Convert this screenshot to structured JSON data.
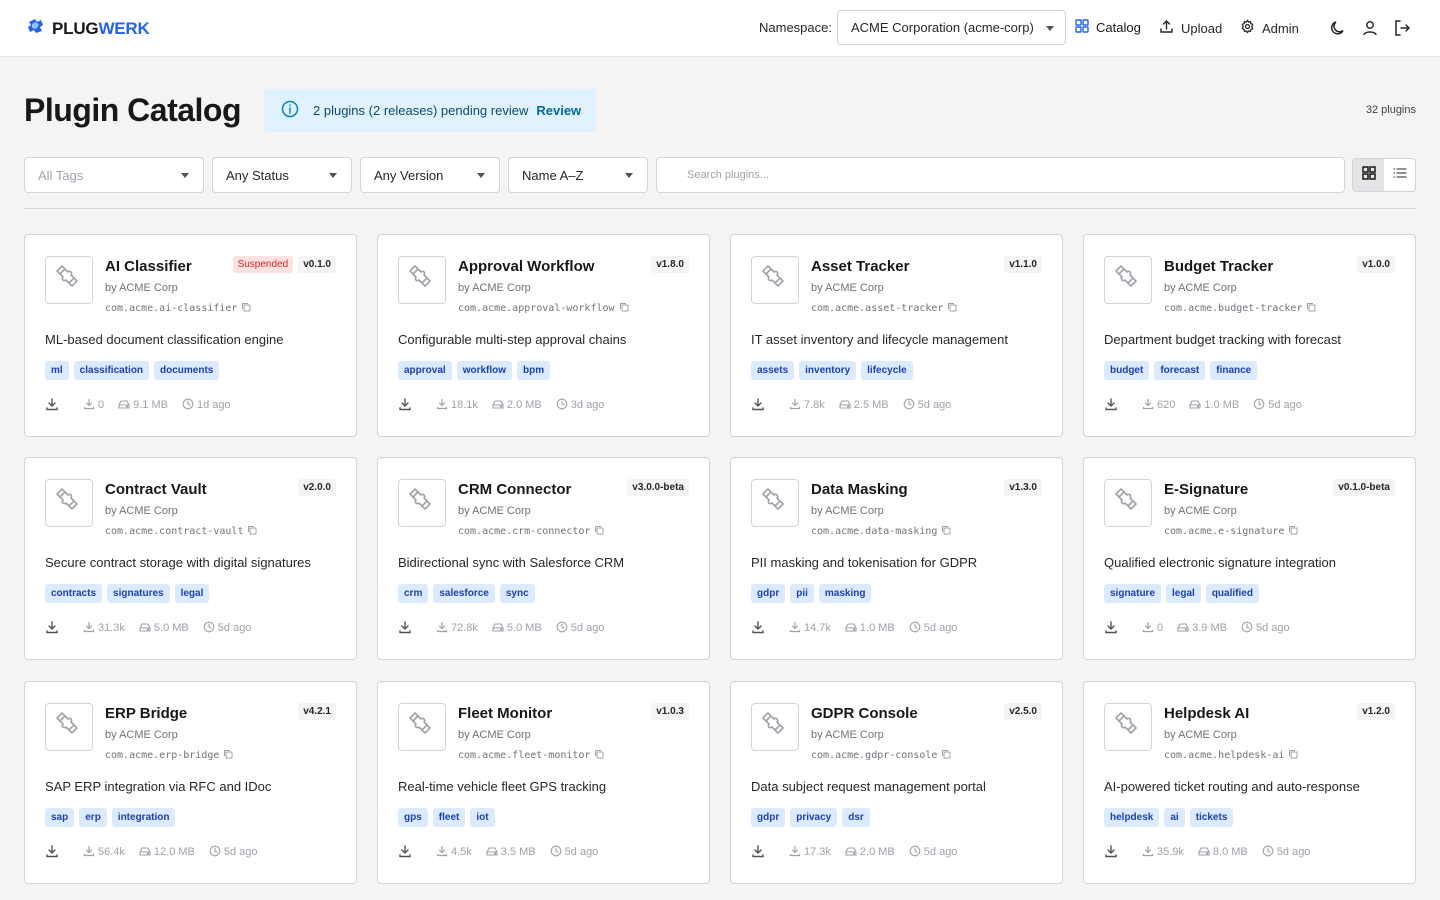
{
  "app": {
    "brand_part1": "PLUG",
    "brand_part2": "WERK"
  },
  "header": {
    "namespace_label": "Namespace:",
    "namespace_value": "ACME Corporation (acme-corp)",
    "nav": {
      "catalog": "Catalog",
      "upload": "Upload",
      "admin": "Admin"
    }
  },
  "page": {
    "title": "Plugin Catalog",
    "review_banner": {
      "text": "2 plugins (2 releases) pending review",
      "link": "Review"
    },
    "count": "32 plugins"
  },
  "filters": {
    "tags": "All Tags",
    "status": "Any Status",
    "version": "Any Version",
    "sort": "Name A–Z",
    "search_placeholder": "Search plugins..."
  },
  "colors": {
    "accent": "#2563eb",
    "tag_bg": "#dbeafe",
    "suspended": "#dc2626"
  },
  "plugins": [
    {
      "name": "AI Classifier",
      "status": "Suspended",
      "version": "v0.1.0",
      "author": "by ACME Corp",
      "id": "com.acme.ai-classifier",
      "description": "ML-based document classification engine",
      "tags": [
        "ml",
        "classification",
        "documents"
      ],
      "downloads": "0",
      "size": "9.1 MB",
      "updated": "1d ago"
    },
    {
      "name": "Approval Workflow",
      "status": "",
      "version": "v1.8.0",
      "author": "by ACME Corp",
      "id": "com.acme.approval-workflow",
      "description": "Configurable multi-step approval chains",
      "tags": [
        "approval",
        "workflow",
        "bpm"
      ],
      "downloads": "18.1k",
      "size": "2.0 MB",
      "updated": "3d ago"
    },
    {
      "name": "Asset Tracker",
      "status": "",
      "version": "v1.1.0",
      "author": "by ACME Corp",
      "id": "com.acme.asset-tracker",
      "description": "IT asset inventory and lifecycle management",
      "tags": [
        "assets",
        "inventory",
        "lifecycle"
      ],
      "downloads": "7.8k",
      "size": "2.5 MB",
      "updated": "5d ago"
    },
    {
      "name": "Budget Tracker",
      "status": "",
      "version": "v1.0.0",
      "author": "by ACME Corp",
      "id": "com.acme.budget-tracker",
      "description": "Department budget tracking with forecast",
      "tags": [
        "budget",
        "forecast",
        "finance"
      ],
      "downloads": "620",
      "size": "1.0 MB",
      "updated": "5d ago"
    },
    {
      "name": "Contract Vault",
      "status": "",
      "version": "v2.0.0",
      "author": "by ACME Corp",
      "id": "com.acme.contract-vault",
      "description": "Secure contract storage with digital signatures",
      "tags": [
        "contracts",
        "signatures",
        "legal"
      ],
      "downloads": "31.3k",
      "size": "5.0 MB",
      "updated": "5d ago"
    },
    {
      "name": "CRM Connector",
      "status": "",
      "version": "v3.0.0-beta",
      "author": "by ACME Corp",
      "id": "com.acme.crm-connector",
      "description": "Bidirectional sync with Salesforce CRM",
      "tags": [
        "crm",
        "salesforce",
        "sync"
      ],
      "downloads": "72.8k",
      "size": "5.0 MB",
      "updated": "5d ago"
    },
    {
      "name": "Data Masking",
      "status": "",
      "version": "v1.3.0",
      "author": "by ACME Corp",
      "id": "com.acme.data-masking",
      "description": "PII masking and tokenisation for GDPR",
      "tags": [
        "gdpr",
        "pii",
        "masking"
      ],
      "downloads": "14.7k",
      "size": "1.0 MB",
      "updated": "5d ago"
    },
    {
      "name": "E-Signature",
      "status": "",
      "version": "v0.1.0-beta",
      "author": "by ACME Corp",
      "id": "com.acme.e-signature",
      "description": "Qualified electronic signature integration",
      "tags": [
        "signature",
        "legal",
        "qualified"
      ],
      "downloads": "0",
      "size": "3.9 MB",
      "updated": "5d ago"
    },
    {
      "name": "ERP Bridge",
      "status": "",
      "version": "v4.2.1",
      "author": "by ACME Corp",
      "id": "com.acme.erp-bridge",
      "description": "SAP ERP integration via RFC and IDoc",
      "tags": [
        "sap",
        "erp",
        "integration"
      ],
      "downloads": "56.4k",
      "size": "12.0 MB",
      "updated": "5d ago"
    },
    {
      "name": "Fleet Monitor",
      "status": "",
      "version": "v1.0.3",
      "author": "by ACME Corp",
      "id": "com.acme.fleet-monitor",
      "description": "Real-time vehicle fleet GPS tracking",
      "tags": [
        "gps",
        "fleet",
        "iot"
      ],
      "downloads": "4.5k",
      "size": "3.5 MB",
      "updated": "5d ago"
    },
    {
      "name": "GDPR Console",
      "status": "",
      "version": "v2.5.0",
      "author": "by ACME Corp",
      "id": "com.acme.gdpr-console",
      "description": "Data subject request management portal",
      "tags": [
        "gdpr",
        "privacy",
        "dsr"
      ],
      "downloads": "17.3k",
      "size": "2.0 MB",
      "updated": "5d ago"
    },
    {
      "name": "Helpdesk AI",
      "status": "",
      "version": "v1.2.0",
      "author": "by ACME Corp",
      "id": "com.acme.helpdesk-ai",
      "description": "AI-powered ticket routing and auto-response",
      "tags": [
        "helpdesk",
        "ai",
        "tickets"
      ],
      "downloads": "35.9k",
      "size": "8.0 MB",
      "updated": "5d ago"
    }
  ]
}
